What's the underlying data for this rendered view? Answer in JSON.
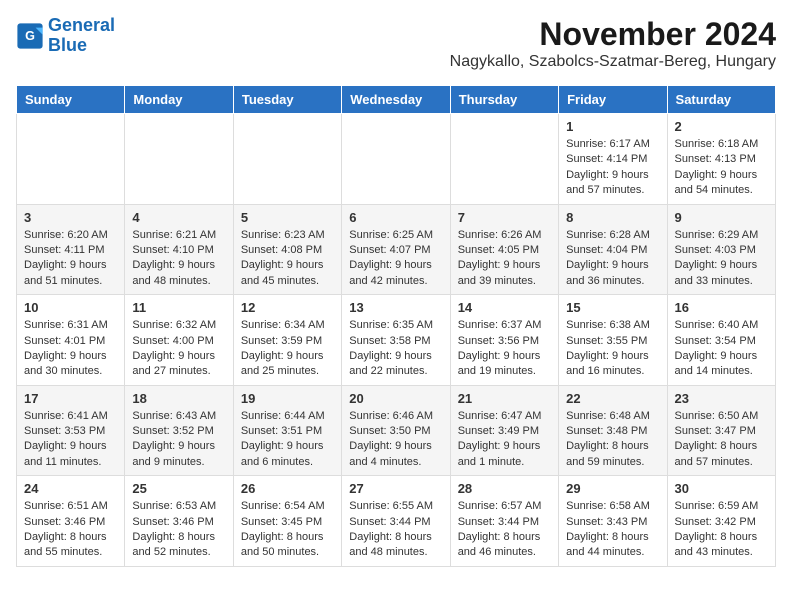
{
  "app": {
    "logo_line1": "General",
    "logo_line2": "Blue"
  },
  "title": "November 2024",
  "location": "Nagykallo, Szabolcs-Szatmar-Bereg, Hungary",
  "days_of_week": [
    "Sunday",
    "Monday",
    "Tuesday",
    "Wednesday",
    "Thursday",
    "Friday",
    "Saturday"
  ],
  "weeks": [
    [
      {
        "day": "",
        "info": ""
      },
      {
        "day": "",
        "info": ""
      },
      {
        "day": "",
        "info": ""
      },
      {
        "day": "",
        "info": ""
      },
      {
        "day": "",
        "info": ""
      },
      {
        "day": "1",
        "info": "Sunrise: 6:17 AM\nSunset: 4:14 PM\nDaylight: 9 hours and 57 minutes."
      },
      {
        "day": "2",
        "info": "Sunrise: 6:18 AM\nSunset: 4:13 PM\nDaylight: 9 hours and 54 minutes."
      }
    ],
    [
      {
        "day": "3",
        "info": "Sunrise: 6:20 AM\nSunset: 4:11 PM\nDaylight: 9 hours and 51 minutes."
      },
      {
        "day": "4",
        "info": "Sunrise: 6:21 AM\nSunset: 4:10 PM\nDaylight: 9 hours and 48 minutes."
      },
      {
        "day": "5",
        "info": "Sunrise: 6:23 AM\nSunset: 4:08 PM\nDaylight: 9 hours and 45 minutes."
      },
      {
        "day": "6",
        "info": "Sunrise: 6:25 AM\nSunset: 4:07 PM\nDaylight: 9 hours and 42 minutes."
      },
      {
        "day": "7",
        "info": "Sunrise: 6:26 AM\nSunset: 4:05 PM\nDaylight: 9 hours and 39 minutes."
      },
      {
        "day": "8",
        "info": "Sunrise: 6:28 AM\nSunset: 4:04 PM\nDaylight: 9 hours and 36 minutes."
      },
      {
        "day": "9",
        "info": "Sunrise: 6:29 AM\nSunset: 4:03 PM\nDaylight: 9 hours and 33 minutes."
      }
    ],
    [
      {
        "day": "10",
        "info": "Sunrise: 6:31 AM\nSunset: 4:01 PM\nDaylight: 9 hours and 30 minutes."
      },
      {
        "day": "11",
        "info": "Sunrise: 6:32 AM\nSunset: 4:00 PM\nDaylight: 9 hours and 27 minutes."
      },
      {
        "day": "12",
        "info": "Sunrise: 6:34 AM\nSunset: 3:59 PM\nDaylight: 9 hours and 25 minutes."
      },
      {
        "day": "13",
        "info": "Sunrise: 6:35 AM\nSunset: 3:58 PM\nDaylight: 9 hours and 22 minutes."
      },
      {
        "day": "14",
        "info": "Sunrise: 6:37 AM\nSunset: 3:56 PM\nDaylight: 9 hours and 19 minutes."
      },
      {
        "day": "15",
        "info": "Sunrise: 6:38 AM\nSunset: 3:55 PM\nDaylight: 9 hours and 16 minutes."
      },
      {
        "day": "16",
        "info": "Sunrise: 6:40 AM\nSunset: 3:54 PM\nDaylight: 9 hours and 14 minutes."
      }
    ],
    [
      {
        "day": "17",
        "info": "Sunrise: 6:41 AM\nSunset: 3:53 PM\nDaylight: 9 hours and 11 minutes."
      },
      {
        "day": "18",
        "info": "Sunrise: 6:43 AM\nSunset: 3:52 PM\nDaylight: 9 hours and 9 minutes."
      },
      {
        "day": "19",
        "info": "Sunrise: 6:44 AM\nSunset: 3:51 PM\nDaylight: 9 hours and 6 minutes."
      },
      {
        "day": "20",
        "info": "Sunrise: 6:46 AM\nSunset: 3:50 PM\nDaylight: 9 hours and 4 minutes."
      },
      {
        "day": "21",
        "info": "Sunrise: 6:47 AM\nSunset: 3:49 PM\nDaylight: 9 hours and 1 minute."
      },
      {
        "day": "22",
        "info": "Sunrise: 6:48 AM\nSunset: 3:48 PM\nDaylight: 8 hours and 59 minutes."
      },
      {
        "day": "23",
        "info": "Sunrise: 6:50 AM\nSunset: 3:47 PM\nDaylight: 8 hours and 57 minutes."
      }
    ],
    [
      {
        "day": "24",
        "info": "Sunrise: 6:51 AM\nSunset: 3:46 PM\nDaylight: 8 hours and 55 minutes."
      },
      {
        "day": "25",
        "info": "Sunrise: 6:53 AM\nSunset: 3:46 PM\nDaylight: 8 hours and 52 minutes."
      },
      {
        "day": "26",
        "info": "Sunrise: 6:54 AM\nSunset: 3:45 PM\nDaylight: 8 hours and 50 minutes."
      },
      {
        "day": "27",
        "info": "Sunrise: 6:55 AM\nSunset: 3:44 PM\nDaylight: 8 hours and 48 minutes."
      },
      {
        "day": "28",
        "info": "Sunrise: 6:57 AM\nSunset: 3:44 PM\nDaylight: 8 hours and 46 minutes."
      },
      {
        "day": "29",
        "info": "Sunrise: 6:58 AM\nSunset: 3:43 PM\nDaylight: 8 hours and 44 minutes."
      },
      {
        "day": "30",
        "info": "Sunrise: 6:59 AM\nSunset: 3:42 PM\nDaylight: 8 hours and 43 minutes."
      }
    ]
  ]
}
